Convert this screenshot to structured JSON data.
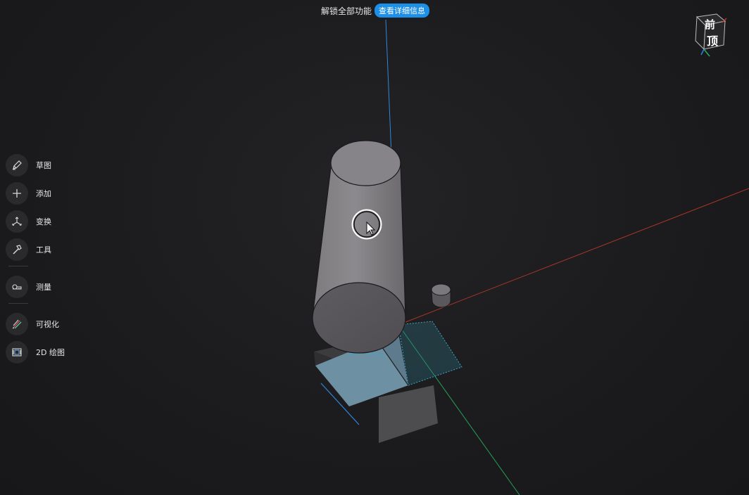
{
  "banner": {
    "label": "解锁全部功能",
    "button": "查看详细信息"
  },
  "toolbar": {
    "items": [
      {
        "label": "草图",
        "icon": "sketch-pen-icon"
      },
      {
        "label": "添加",
        "icon": "plus-icon"
      },
      {
        "label": "变换",
        "icon": "transform-icon"
      },
      {
        "label": "工具",
        "icon": "hammer-icon"
      },
      {
        "label": "测量",
        "icon": "ruler-tape-icon"
      },
      {
        "label": "可视化",
        "icon": "visualize-icon"
      },
      {
        "label": "2D 绘图",
        "icon": "drawing-2d-icon"
      }
    ]
  },
  "view_cube": {
    "front_label": "前",
    "top_label": "顶"
  },
  "colors": {
    "accent": "#1e8fe6",
    "axis_x": "#c0392b",
    "axis_y": "#27ae60",
    "axis_z": "#2e86de"
  }
}
